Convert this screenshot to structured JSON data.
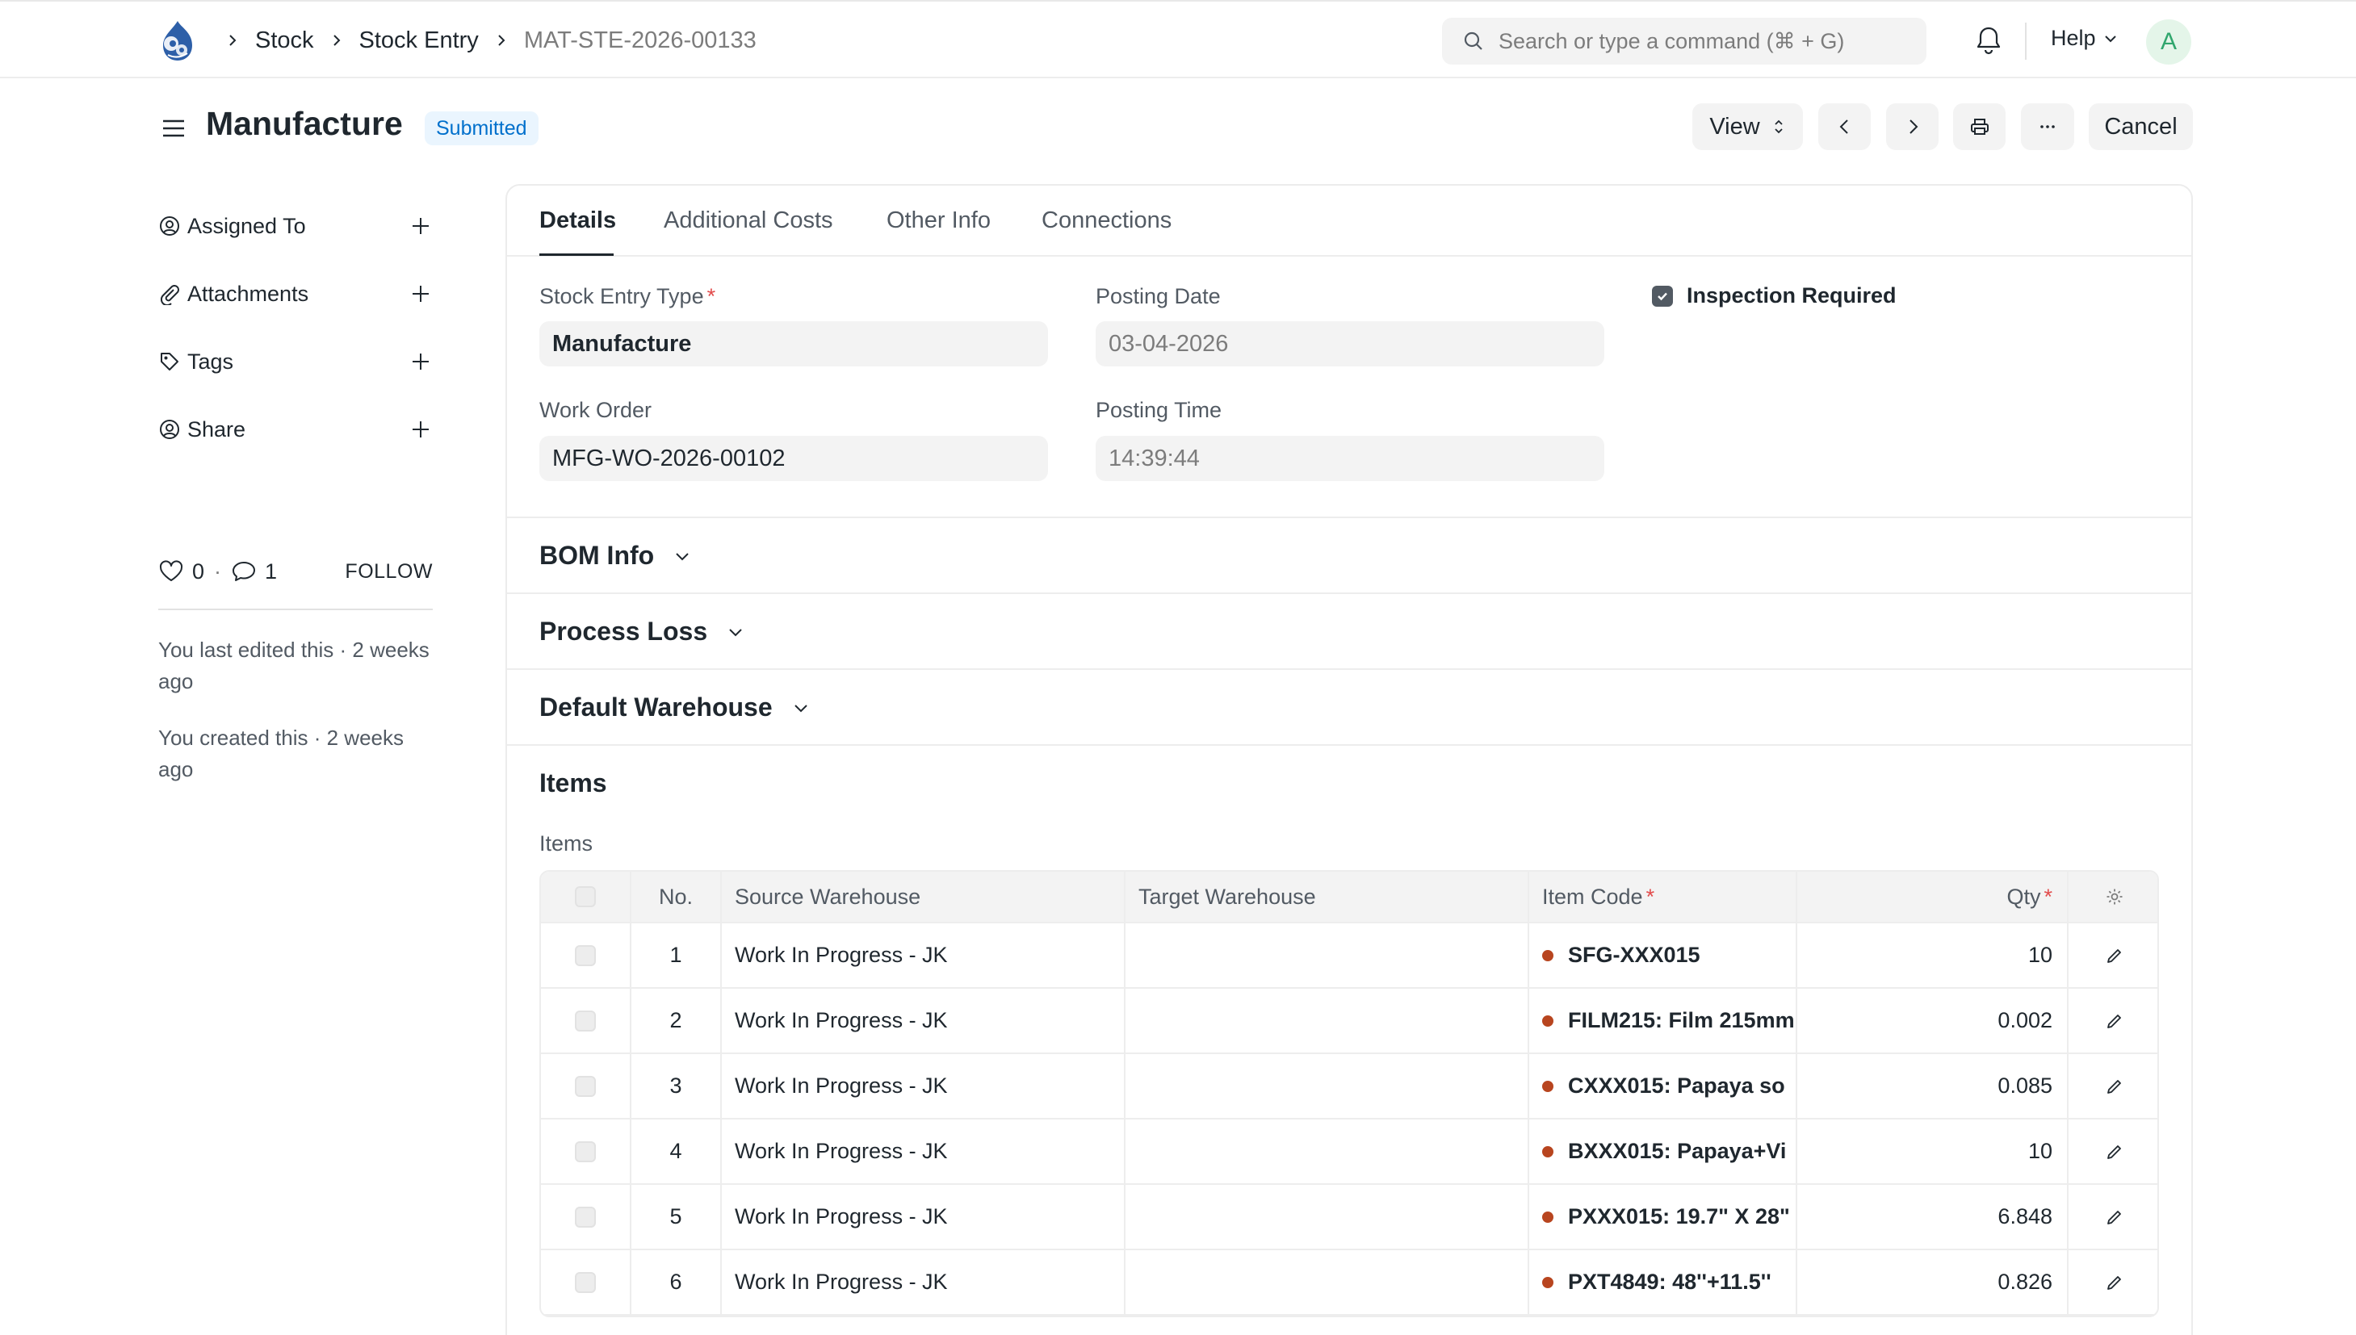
{
  "breadcrumbs": [
    "Stock",
    "Stock Entry",
    "MAT-STE-2026-00133"
  ],
  "search": {
    "placeholder": "Search or type a command (⌘ + G)"
  },
  "navbar": {
    "help_label": "Help",
    "avatar_letter": "A"
  },
  "page": {
    "title": "Manufacture",
    "status": "Submitted"
  },
  "actions": {
    "view_label": "View",
    "cancel_label": "Cancel"
  },
  "sidebar": {
    "items": [
      {
        "label": "Assigned To",
        "icon": "assign-icon"
      },
      {
        "label": "Attachments",
        "icon": "paperclip-icon"
      },
      {
        "label": "Tags",
        "icon": "tag-icon"
      },
      {
        "label": "Share",
        "icon": "share-icon"
      }
    ],
    "likes": "0",
    "comments": "1",
    "follow_label": "FOLLOW",
    "last_edited": "You last edited this · 2 weeks ago",
    "created": "You created this · 2 weeks ago"
  },
  "tabs": [
    "Details",
    "Additional Costs",
    "Other Info",
    "Connections"
  ],
  "form": {
    "stock_entry_type": {
      "label": "Stock Entry Type",
      "value": "Manufacture"
    },
    "posting_date": {
      "label": "Posting Date",
      "value": "03-04-2026"
    },
    "inspection_required": {
      "label": "Inspection Required",
      "checked": true
    },
    "work_order": {
      "label": "Work Order",
      "value": "MFG-WO-2026-00102"
    },
    "posting_time": {
      "label": "Posting Time",
      "value": "14:39:44"
    }
  },
  "sections": {
    "bom_info": "BOM Info",
    "process_loss": "Process Loss",
    "default_warehouse": "Default Warehouse",
    "items": "Items"
  },
  "items_table": {
    "label": "Items",
    "columns": {
      "no": "No.",
      "source": "Source Warehouse",
      "target": "Target Warehouse",
      "item_code": "Item Code",
      "qty": "Qty"
    },
    "status_color": "#b8451f",
    "rows": [
      {
        "no": "1",
        "source": "Work In Progress - JK",
        "target": "",
        "item_code": "SFG-XXX015",
        "qty": "10"
      },
      {
        "no": "2",
        "source": "Work In Progress - JK",
        "target": "",
        "item_code": "FILM215: Film 215mm",
        "qty": "0.002"
      },
      {
        "no": "3",
        "source": "Work In Progress - JK",
        "target": "",
        "item_code": "CXXX015: Papaya so",
        "qty": "0.085"
      },
      {
        "no": "4",
        "source": "Work In Progress - JK",
        "target": "",
        "item_code": "BXXX015: Papaya+Vi",
        "qty": "10"
      },
      {
        "no": "5",
        "source": "Work In Progress - JK",
        "target": "",
        "item_code": "PXXX015: 19.7\" X 28\"",
        "qty": "6.848"
      },
      {
        "no": "6",
        "source": "Work In Progress - JK",
        "target": "",
        "item_code": "PXT4849: 48''+11.5''",
        "qty": "0.826"
      }
    ]
  }
}
